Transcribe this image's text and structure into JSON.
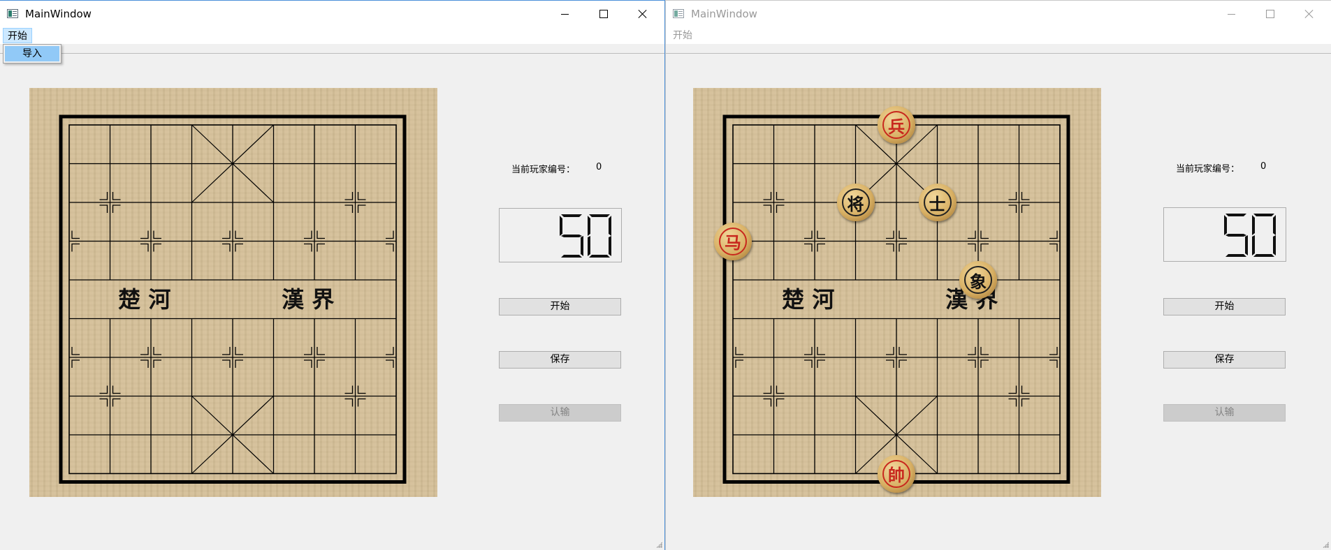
{
  "windows": [
    {
      "title": "MainWindow",
      "menu": {
        "label": "开始",
        "dropdown_item": "导入"
      },
      "board": {
        "river_left": "楚 河",
        "river_right": "漢 界",
        "pieces": []
      },
      "side": {
        "player_label": "当前玩家编号：",
        "player_value": "0",
        "timer": "50",
        "buttons": {
          "start": "开始",
          "save": "保存",
          "resign": "认输"
        }
      }
    },
    {
      "title": "MainWindow",
      "menu": {
        "label": "开始"
      },
      "board": {
        "river_left": "楚 河",
        "river_right": "漢 界",
        "pieces": [
          {
            "char": "兵",
            "side": "red",
            "file": 4,
            "rank": 0
          },
          {
            "char": "将",
            "side": "black",
            "file": 3,
            "rank": 2
          },
          {
            "char": "士",
            "side": "black",
            "file": 5,
            "rank": 2
          },
          {
            "char": "马",
            "side": "red",
            "file": 0,
            "rank": 3
          },
          {
            "char": "象",
            "side": "black",
            "file": 6,
            "rank": 4
          },
          {
            "char": "帥",
            "side": "red",
            "file": 4,
            "rank": 9
          }
        ]
      },
      "side": {
        "player_label": "当前玩家编号：",
        "player_value": "0",
        "timer": "50",
        "buttons": {
          "start": "开始",
          "save": "保存",
          "resign": "认输"
        }
      }
    }
  ],
  "colors": {
    "board_wood": "#d4bf97",
    "red_piece": "#c8281e",
    "focus_border": "#4a90d9"
  }
}
